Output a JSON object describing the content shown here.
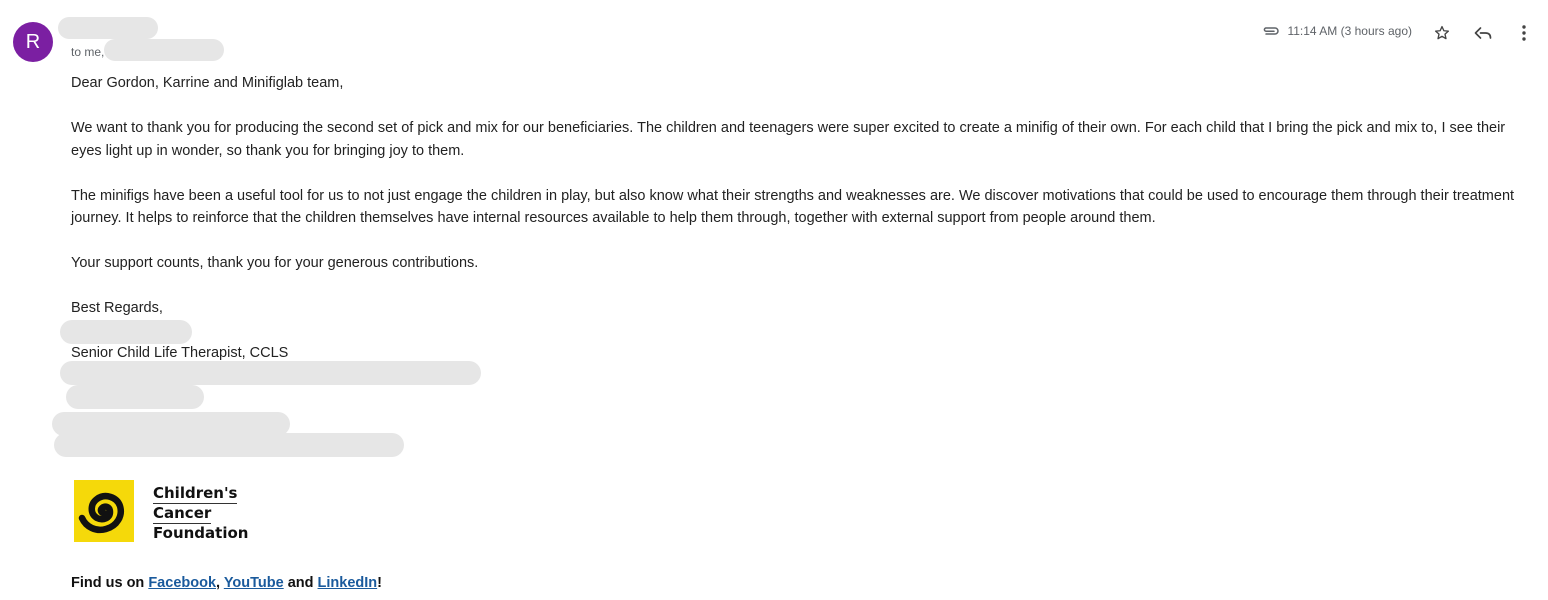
{
  "sender": {
    "avatar_letter": "R",
    "avatar_color": "#7b1fa2"
  },
  "recipients": {
    "to_label": "to me,"
  },
  "meta": {
    "timestamp": "11:14 AM (3 hours ago)"
  },
  "actions": {
    "star": "star-icon",
    "reply": "reply-icon",
    "more": "more-vert-icon"
  },
  "email": {
    "greeting": "Dear Gordon, Karrine and Minifiglab team,",
    "paragraph_1": "We want to thank you for producing the second set of pick and mix for our beneficiaries. The children and teenagers were super excited to create a minifig of their own. For each child that I bring the pick and mix to, I see their eyes light up in wonder, so thank you for bringing joy to them.",
    "paragraph_2": "The minifigs have been a useful tool for us to not just engage the children in play, but also know what their strengths and weaknesses are. We discover motivations that could be used to encourage them through their treatment journey. It helps to reinforce that the children themselves have internal resources available to help them through, together with external support from people around them.",
    "paragraph_3": "Your support counts, thank you for your generous contributions.",
    "signoff": "Best Regards,",
    "signature_title": "Senior Child Life Therapist, CCLS"
  },
  "logo": {
    "line1": "Children's",
    "line2": "Cancer",
    "line3": "Foundation",
    "mark_bg": "#f5d90a"
  },
  "footer": {
    "prefix": "Find us on ",
    "facebook": "Facebook",
    "sep1": ", ",
    "youtube": "YouTube",
    "sep2": " and ",
    "linkedin": "LinkedIn",
    "suffix": "!"
  }
}
